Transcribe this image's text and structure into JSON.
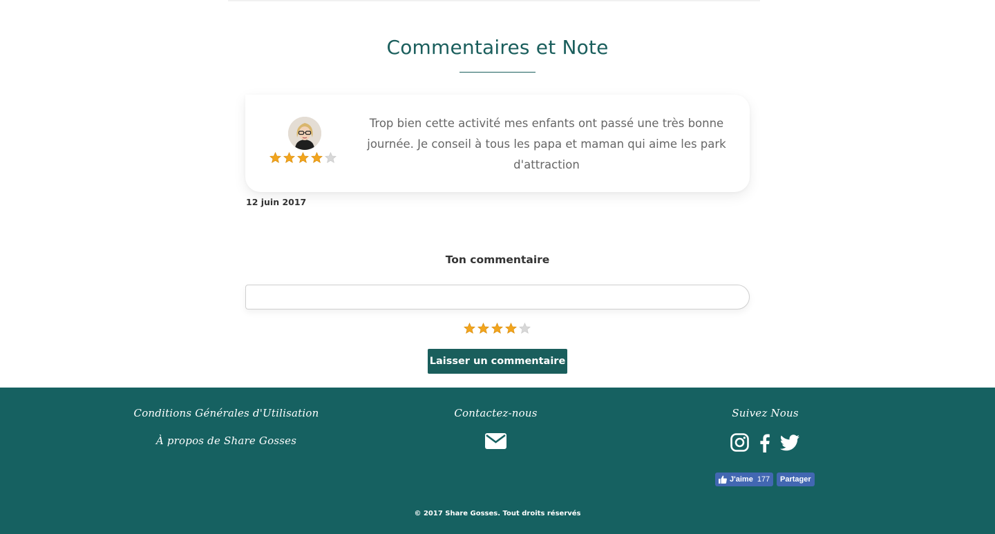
{
  "section": {
    "title": "Commentaires et Note"
  },
  "comment": {
    "rating": 4,
    "text": "Trop bien cette activité mes enfants ont passé une très bonne journée. Je conseil à tous les papa et maman qui aime les park d'attraction",
    "date": "12 juin 2017"
  },
  "form": {
    "label": "Ton commentaire",
    "input_value": "",
    "input_placeholder": "",
    "rating": 4,
    "submit_label": "Laisser un commentaire"
  },
  "footer": {
    "cgu_link": "Conditions Générales d'Utilisation",
    "about_link": "À propos de Share Gosses",
    "contact_title": "Contactez-nous",
    "follow_title": "Suivez Nous",
    "social_icons": [
      "instagram-icon",
      "facebook-icon",
      "twitter-icon"
    ],
    "fb_like_label": "J'aime",
    "fb_like_count": "177",
    "fb_share_label": "Partager",
    "copyright": "© 2017 Share Gosses. Tout droits réservés"
  },
  "colors": {
    "primary": "#1a5e5c",
    "footer_bg": "#166161",
    "star_filled": "#f2a51e",
    "star_empty": "#d8d8d8",
    "facebook": "#4267b2"
  }
}
